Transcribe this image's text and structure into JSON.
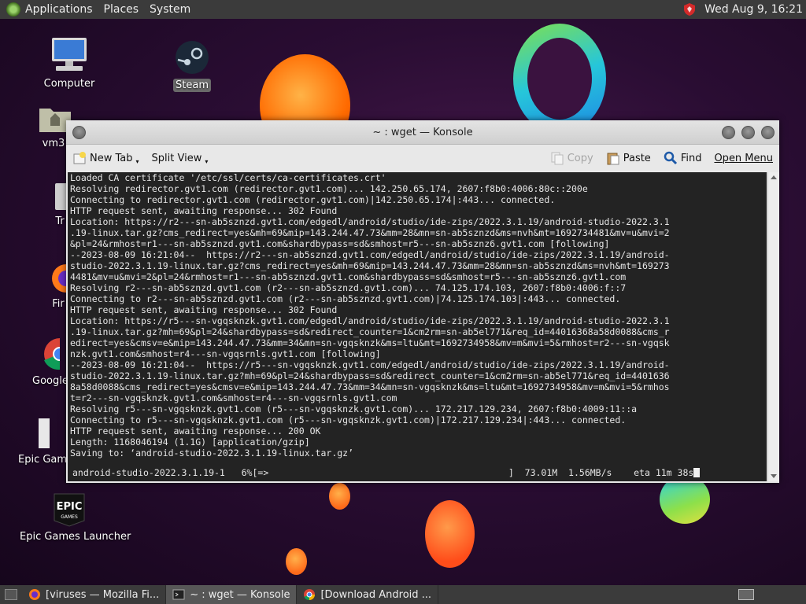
{
  "top_panel": {
    "menus": [
      "Applications",
      "Places",
      "System"
    ],
    "clock": "Wed Aug  9, 16:21"
  },
  "desktop": {
    "icons": [
      {
        "label": "Computer"
      },
      {
        "label": "Steam"
      },
      {
        "label": "vm3"
      },
      {
        "label": "Tr"
      },
      {
        "label": "Fir"
      },
      {
        "label": "Google"
      },
      {
        "label": "Epic Game"
      },
      {
        "label": "Epic Games Launcher"
      }
    ]
  },
  "konsole": {
    "title": "~ : wget — Konsole",
    "toolbar": {
      "new_tab": "New Tab",
      "split_view": "Split View",
      "copy": "Copy",
      "paste": "Paste",
      "find": "Find",
      "open_menu": "Open Menu"
    },
    "terminal_lines": [
      "Loaded CA certificate '/etc/ssl/certs/ca-certificates.crt'",
      "Resolving redirector.gvt1.com (redirector.gvt1.com)... 142.250.65.174, 2607:f8b0:4006:80c::200e",
      "Connecting to redirector.gvt1.com (redirector.gvt1.com)|142.250.65.174|:443... connected.",
      "HTTP request sent, awaiting response... 302 Found",
      "Location: https://r2---sn-ab5sznzd.gvt1.com/edgedl/android/studio/ide-zips/2022.3.1.19/android-studio-2022.3.1",
      ".19-linux.tar.gz?cms_redirect=yes&mh=69&mip=143.244.47.73&mm=28&mn=sn-ab5sznzd&ms=nvh&mt=1692734481&mv=u&mvi=2",
      "&pl=24&rmhost=r1---sn-ab5sznzd.gvt1.com&shardbypass=sd&smhost=r5---sn-ab5sznz6.gvt1.com [following]",
      "--2023-08-09 16:21:04--  https://r2---sn-ab5sznzd.gvt1.com/edgedl/android/studio/ide-zips/2022.3.1.19/android-",
      "studio-2022.3.1.19-linux.tar.gz?cms_redirect=yes&mh=69&mip=143.244.47.73&mm=28&mn=sn-ab5sznzd&ms=nvh&mt=169273",
      "4481&mv=u&mvi=2&pl=24&rmhost=r1---sn-ab5sznzd.gvt1.com&shardbypass=sd&smhost=r5---sn-ab5sznz6.gvt1.com",
      "Resolving r2---sn-ab5sznzd.gvt1.com (r2---sn-ab5sznzd.gvt1.com)... 74.125.174.103, 2607:f8b0:4006:f::7",
      "Connecting to r2---sn-ab5sznzd.gvt1.com (r2---sn-ab5sznzd.gvt1.com)|74.125.174.103|:443... connected.",
      "HTTP request sent, awaiting response... 302 Found",
      "Location: https://r5---sn-vgqsknzk.gvt1.com/edgedl/android/studio/ide-zips/2022.3.1.19/android-studio-2022.3.1",
      ".19-linux.tar.gz?mh=69&pl=24&shardbypass=sd&redirect_counter=1&cm2rm=sn-ab5el771&req_id=44016368a58d0088&cms_r",
      "edirect=yes&cmsv=e&mip=143.244.47.73&mm=34&mn=sn-vgqsknzk&ms=ltu&mt=1692734958&mv=m&mvi=5&rmhost=r2---sn-vgqsk",
      "nzk.gvt1.com&smhost=r4---sn-vgqsrnls.gvt1.com [following]",
      "--2023-08-09 16:21:04--  https://r5---sn-vgqsknzk.gvt1.com/edgedl/android/studio/ide-zips/2022.3.1.19/android-",
      "studio-2022.3.1.19-linux.tar.gz?mh=69&pl=24&shardbypass=sd&redirect_counter=1&cm2rm=sn-ab5el771&req_id=4401636",
      "8a58d0088&cms_redirect=yes&cmsv=e&mip=143.244.47.73&mm=34&mn=sn-vgqsknzk&ms=ltu&mt=1692734958&mv=m&mvi=5&rmhos",
      "t=r2---sn-vgqsknzk.gvt1.com&smhost=r4---sn-vgqsrnls.gvt1.com",
      "Resolving r5---sn-vgqsknzk.gvt1.com (r5---sn-vgqsknzk.gvt1.com)... 172.217.129.234, 2607:f8b0:4009:11::a",
      "Connecting to r5---sn-vgqsknzk.gvt1.com (r5---sn-vgqsknzk.gvt1.com)|172.217.129.234|:443... connected.",
      "HTTP request sent, awaiting response... 200 OK",
      "Length: 1168046194 (1.1G) [application/gzip]",
      "Saving to: ‘android-studio-2022.3.1.19-linux.tar.gz’"
    ],
    "progress_line": "android-studio-2022.3.1.19-1   6%[=>                                            ]  73.01M  1.56MB/s    eta 11m 38s"
  },
  "taskbar": {
    "tasks": [
      {
        "label": "[viruses — Mozilla Fi..."
      },
      {
        "label": "~ : wget — Konsole"
      },
      {
        "label": "[Download Android ..."
      }
    ]
  },
  "colors": {
    "panel": "#3b3b3b",
    "terminal_bg": "#232323",
    "terminal_fg": "#e6e6e6"
  }
}
